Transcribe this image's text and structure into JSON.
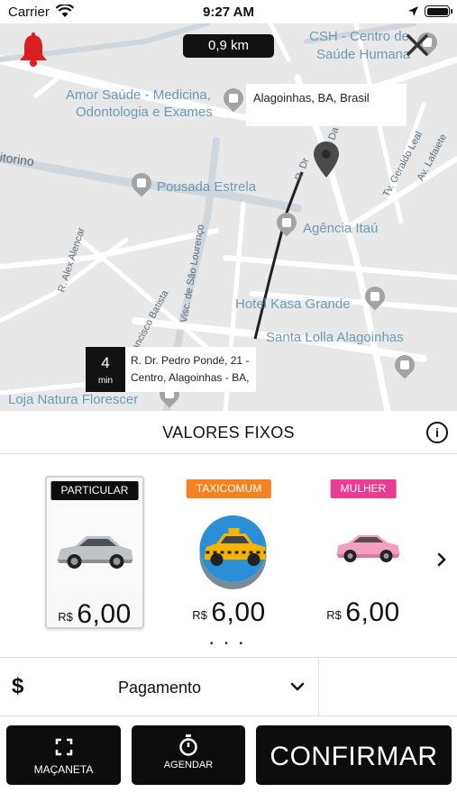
{
  "status_bar": {
    "carrier": "Carrier",
    "time": "9:27 AM"
  },
  "map": {
    "distance": "0,9 km",
    "destination": "Alagoinhas, BA, Brasil",
    "eta": {
      "value": "4",
      "unit": "min"
    },
    "origin_address": "R. Dr. Pedro Pondé, 21 - Centro, Alagoinhas - BA,",
    "pois": [
      "CSH - Centro de",
      "Saúde Humana",
      "Amor Saúde - Medicina,",
      "Odontologia e Exames",
      "Pousada Estrela",
      "Agência Itaú",
      "Hotel Kasa Grande",
      "Santa Lolla Alagoinhas",
      "Loja Natura Florescer"
    ],
    "streets": [
      "R. Alex Alencar",
      "R. Francisco Batista",
      "Visc. de São Lourenço",
      "Tv. Geraldo Leal",
      "Av. Lafaiete",
      "itorino",
      "R. Dr",
      "Da"
    ]
  },
  "fixed_values": {
    "title": "VALORES FIXOS",
    "info_icon": "i"
  },
  "vehicles": [
    {
      "tag": "PARTICULAR",
      "tag_color": "#0d0d0d",
      "currency": "R$",
      "price": "6,00",
      "selected": true
    },
    {
      "tag": "TAXICOMUM",
      "tag_color": "#f58220",
      "currency": "R$",
      "price": "6,00",
      "selected": false
    },
    {
      "tag": "MULHER",
      "tag_color": "#ec3b92",
      "currency": "R$",
      "price": "6,00",
      "selected": false
    }
  ],
  "pager": "• • •",
  "payment": {
    "icon": "$",
    "label": "Pagamento"
  },
  "actions": {
    "macaneta": "MAÇANETA",
    "agendar": "AGENDAR",
    "confirmar": "CONFIRMAR"
  }
}
